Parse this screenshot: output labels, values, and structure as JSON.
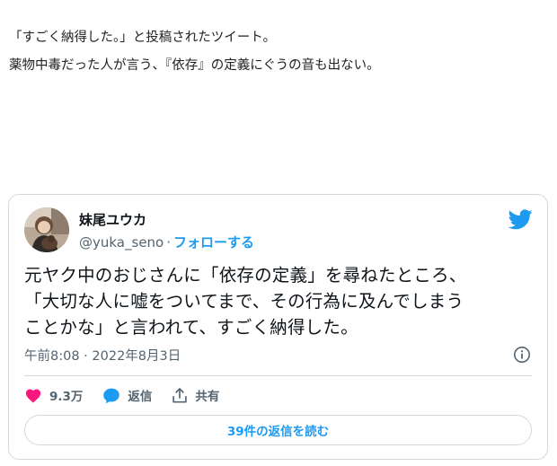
{
  "intro": {
    "line1": "「すごく納得した。」と投稿されたツイート。",
    "line2": "薬物中毒だった人が言う、『依存』の定義にぐうの音も出ない。"
  },
  "tweet": {
    "author_name": "妹尾ユウカ",
    "handle": "@yuka_seno",
    "separator": "·",
    "follow_label": "フォローする",
    "text_lines": [
      "元ヤク中のおじさんに「依存の定義」を尋ねたところ、",
      "「大切な人に嘘をついてまで、その行為に及んでしまう",
      "ことかな」と言われて、すごく納得した。"
    ],
    "timestamp": "午前8:08 · 2022年8月3日",
    "like_count": "9.3万",
    "reply_label": "返信",
    "share_label": "共有",
    "read_replies_label": "39件の返信を読む"
  },
  "icons": {
    "brand": "twitter-bird-icon",
    "info": "info-icon",
    "like": "heart-icon",
    "reply": "speech-bubble-icon",
    "share": "share-icon"
  },
  "colors": {
    "accent": "#1d9bf0",
    "like": "#f91880",
    "text": "#0f1419",
    "muted": "#536471",
    "border": "#cfd9de"
  }
}
